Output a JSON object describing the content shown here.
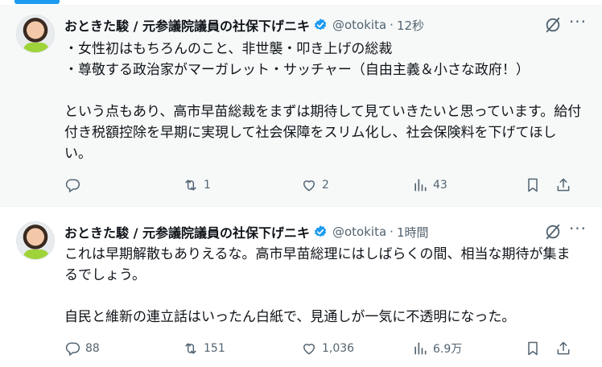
{
  "tweets": [
    {
      "author_name": "おときた駿 / 元参議院議員の社保下げニキ",
      "handle": "@otokita",
      "separator": "·",
      "time": "12秒",
      "body": "・女性初はもちろんのこと、非世襲・叩き上げの総裁\n・尊敬する政治家がマーガレット・サッチャー（自由主義＆小さな政府！）\n\nという点もあり、高市早苗総裁をまずは期待して見ていきたいと思っています。給付付き税額控除を早期に実現して社会保障をスリム化し、社会保険料を下げてほしい。",
      "replies": "",
      "retweets": "1",
      "likes": "2",
      "views": "43"
    },
    {
      "author_name": "おときた駿 / 元参議院議員の社保下げニキ",
      "handle": "@otokita",
      "separator": "·",
      "time": "1時間",
      "body": "これは早期解散もありえるな。高市早苗総理にはしばらくの間、相当な期待が集まるでしょう。\n\n自民と維新の連立話はいったん白紙で、見通しが一気に不透明になった。",
      "replies": "88",
      "retweets": "151",
      "likes": "1,036",
      "views": "6.9万"
    }
  ],
  "icons": {
    "verified": "verified-badge-icon",
    "grok": "grok-icon",
    "more": "more-icon",
    "reply": "reply-icon",
    "retweet": "retweet-icon",
    "like": "like-icon",
    "views": "views-icon",
    "bookmark": "bookmark-icon",
    "share": "share-icon"
  },
  "colors": {
    "accent": "#1d9bf0",
    "text": "#0f1419",
    "secondary": "#536471",
    "highlight_bg": "#f7f9f9"
  }
}
